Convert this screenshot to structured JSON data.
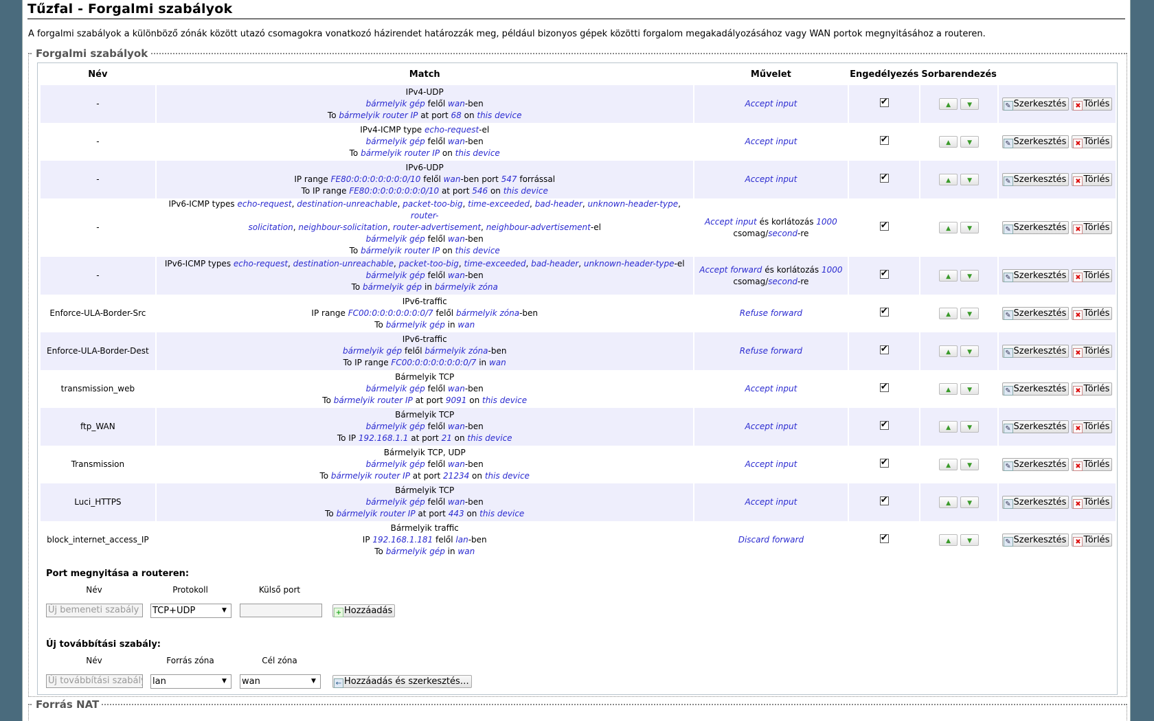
{
  "title": "Tűzfal - Forgalmi szabályok",
  "description": "A forgalmi szabályok a különböző zónák között utazó csomagokra vonatkozó házirendet határozzák meg, például bizonyos gépek közötti forgalom megakadályozásához vagy WAN portok megnyitásához a routeren.",
  "rules_section": {
    "legend": "Forgalmi szabályok",
    "headers": [
      "Név",
      "Match",
      "Művelet",
      "Engedélyezés",
      "Sorbarendezés"
    ],
    "edit_label": "Szerkesztés",
    "delete_label": "Törlés"
  },
  "rules": [
    {
      "name": "-",
      "match": [
        [
          {
            "t": "IPv4-UDP"
          }
        ],
        [
          {
            "t": "bármelyik gép",
            "e": 1
          },
          {
            "t": " felől "
          },
          {
            "t": "wan",
            "e": 1
          },
          {
            "t": "-ben"
          }
        ],
        [
          {
            "t": "To "
          },
          {
            "t": "bármelyik router IP",
            "e": 1
          },
          {
            "t": " at port "
          },
          {
            "t": "68",
            "e": 1
          },
          {
            "t": " on "
          },
          {
            "t": "this device",
            "e": 1
          }
        ]
      ],
      "action": [
        [
          {
            "t": "Accept input",
            "e": 1
          }
        ]
      ],
      "enabled": true
    },
    {
      "name": "-",
      "match": [
        [
          {
            "t": "IPv4-ICMP type "
          },
          {
            "t": "echo-request",
            "e": 1
          },
          {
            "t": "-el"
          }
        ],
        [
          {
            "t": "bármelyik gép",
            "e": 1
          },
          {
            "t": " felől "
          },
          {
            "t": "wan",
            "e": 1
          },
          {
            "t": "-ben"
          }
        ],
        [
          {
            "t": "To "
          },
          {
            "t": "bármelyik router IP",
            "e": 1
          },
          {
            "t": " on "
          },
          {
            "t": "this device",
            "e": 1
          }
        ]
      ],
      "action": [
        [
          {
            "t": "Accept input",
            "e": 1
          }
        ]
      ],
      "enabled": true
    },
    {
      "name": "-",
      "match": [
        [
          {
            "t": "IPv6-UDP"
          }
        ],
        [
          {
            "t": "IP range "
          },
          {
            "t": "FE80:0:0:0:0:0:0:0/10",
            "e": 1
          },
          {
            "t": " felől "
          },
          {
            "t": "wan",
            "e": 1
          },
          {
            "t": "-ben port "
          },
          {
            "t": "547",
            "e": 1
          },
          {
            "t": " forrással"
          }
        ],
        [
          {
            "t": "To IP range "
          },
          {
            "t": "FE80:0:0:0:0:0:0:0/10",
            "e": 1
          },
          {
            "t": " at port "
          },
          {
            "t": "546",
            "e": 1
          },
          {
            "t": " on "
          },
          {
            "t": "this device",
            "e": 1
          }
        ]
      ],
      "action": [
        [
          {
            "t": "Accept input",
            "e": 1
          }
        ]
      ],
      "enabled": true
    },
    {
      "name": "-",
      "match": [
        [
          {
            "t": "IPv6-ICMP types "
          },
          {
            "t": "echo-request",
            "e": 1
          },
          {
            "t": ", "
          },
          {
            "t": "destination-unreachable",
            "e": 1
          },
          {
            "t": ", "
          },
          {
            "t": "packet-too-big",
            "e": 1
          },
          {
            "t": ", "
          },
          {
            "t": "time-exceeded",
            "e": 1
          },
          {
            "t": ", "
          },
          {
            "t": "bad-header",
            "e": 1
          },
          {
            "t": ", "
          },
          {
            "t": "unknown-header-type",
            "e": 1
          },
          {
            "t": ", "
          },
          {
            "t": "router-",
            "e": 1
          }
        ],
        [
          {
            "t": "solicitation",
            "e": 1
          },
          {
            "t": ", "
          },
          {
            "t": "neighbour-solicitation",
            "e": 1
          },
          {
            "t": ", "
          },
          {
            "t": "router-advertisement",
            "e": 1
          },
          {
            "t": ", "
          },
          {
            "t": "neighbour-advertisement",
            "e": 1
          },
          {
            "t": "-el"
          }
        ],
        [
          {
            "t": "bármelyik gép",
            "e": 1
          },
          {
            "t": " felől "
          },
          {
            "t": "wan",
            "e": 1
          },
          {
            "t": "-ben"
          }
        ],
        [
          {
            "t": "To "
          },
          {
            "t": "bármelyik router IP",
            "e": 1
          },
          {
            "t": " on "
          },
          {
            "t": "this device",
            "e": 1
          }
        ]
      ],
      "action": [
        [
          {
            "t": "Accept input",
            "e": 1
          },
          {
            "t": " és korlátozás "
          },
          {
            "t": "1000",
            "e": 1
          }
        ],
        [
          {
            "t": "csomag/"
          },
          {
            "t": "second",
            "e": 1
          },
          {
            "t": "-re"
          }
        ]
      ],
      "enabled": true
    },
    {
      "name": "-",
      "match": [
        [
          {
            "t": "IPv6-ICMP types "
          },
          {
            "t": "echo-request",
            "e": 1
          },
          {
            "t": ", "
          },
          {
            "t": "destination-unreachable",
            "e": 1
          },
          {
            "t": ", "
          },
          {
            "t": "packet-too-big",
            "e": 1
          },
          {
            "t": ", "
          },
          {
            "t": "time-exceeded",
            "e": 1
          },
          {
            "t": ", "
          },
          {
            "t": "bad-header",
            "e": 1
          },
          {
            "t": ", "
          },
          {
            "t": "unknown-header-type",
            "e": 1
          },
          {
            "t": "-el"
          }
        ],
        [
          {
            "t": "bármelyik gép",
            "e": 1
          },
          {
            "t": " felől "
          },
          {
            "t": "wan",
            "e": 1
          },
          {
            "t": "-ben"
          }
        ],
        [
          {
            "t": "To "
          },
          {
            "t": "bármelyik gép",
            "e": 1
          },
          {
            "t": " in "
          },
          {
            "t": "bármelyik zóna",
            "e": 1
          }
        ]
      ],
      "action": [
        [
          {
            "t": "Accept forward",
            "e": 1
          },
          {
            "t": " és korlátozás "
          },
          {
            "t": "1000",
            "e": 1
          }
        ],
        [
          {
            "t": "csomag/"
          },
          {
            "t": "second",
            "e": 1
          },
          {
            "t": "-re"
          }
        ]
      ],
      "enabled": true
    },
    {
      "name": "Enforce-ULA-Border-Src",
      "match": [
        [
          {
            "t": "IPv6-traffic"
          }
        ],
        [
          {
            "t": "IP range "
          },
          {
            "t": "FC00:0:0:0:0:0:0:0/7",
            "e": 1
          },
          {
            "t": " felől "
          },
          {
            "t": "bármelyik zóna",
            "e": 1
          },
          {
            "t": "-ben"
          }
        ],
        [
          {
            "t": "To "
          },
          {
            "t": "bármelyik gép",
            "e": 1
          },
          {
            "t": " in "
          },
          {
            "t": "wan",
            "e": 1
          }
        ]
      ],
      "action": [
        [
          {
            "t": "Refuse forward",
            "e": 1
          }
        ]
      ],
      "enabled": true
    },
    {
      "name": "Enforce-ULA-Border-Dest",
      "match": [
        [
          {
            "t": "IPv6-traffic"
          }
        ],
        [
          {
            "t": "bármelyik gép",
            "e": 1
          },
          {
            "t": " felől "
          },
          {
            "t": "bármelyik zóna",
            "e": 1
          },
          {
            "t": "-ben"
          }
        ],
        [
          {
            "t": "To IP range "
          },
          {
            "t": "FC00:0:0:0:0:0:0:0/7",
            "e": 1
          },
          {
            "t": " in "
          },
          {
            "t": "wan",
            "e": 1
          }
        ]
      ],
      "action": [
        [
          {
            "t": "Refuse forward",
            "e": 1
          }
        ]
      ],
      "enabled": true
    },
    {
      "name": "transmission_web",
      "match": [
        [
          {
            "t": "Bármelyik TCP"
          }
        ],
        [
          {
            "t": "bármelyik gép",
            "e": 1
          },
          {
            "t": " felől "
          },
          {
            "t": "wan",
            "e": 1
          },
          {
            "t": "-ben"
          }
        ],
        [
          {
            "t": "To "
          },
          {
            "t": "bármelyik router IP",
            "e": 1
          },
          {
            "t": " at port "
          },
          {
            "t": "9091",
            "e": 1
          },
          {
            "t": " on "
          },
          {
            "t": "this device",
            "e": 1
          }
        ]
      ],
      "action": [
        [
          {
            "t": "Accept input",
            "e": 1
          }
        ]
      ],
      "enabled": true
    },
    {
      "name": "ftp_WAN",
      "match": [
        [
          {
            "t": "Bármelyik TCP"
          }
        ],
        [
          {
            "t": "bármelyik gép",
            "e": 1
          },
          {
            "t": " felől "
          },
          {
            "t": "wan",
            "e": 1
          },
          {
            "t": "-ben"
          }
        ],
        [
          {
            "t": "To IP "
          },
          {
            "t": "192.168.1.1",
            "e": 1
          },
          {
            "t": " at port "
          },
          {
            "t": "21",
            "e": 1
          },
          {
            "t": " on "
          },
          {
            "t": "this device",
            "e": 1
          }
        ]
      ],
      "action": [
        [
          {
            "t": "Accept input",
            "e": 1
          }
        ]
      ],
      "enabled": true
    },
    {
      "name": "Transmission",
      "match": [
        [
          {
            "t": "Bármelyik TCP, UDP"
          }
        ],
        [
          {
            "t": "bármelyik gép",
            "e": 1
          },
          {
            "t": " felől "
          },
          {
            "t": "wan",
            "e": 1
          },
          {
            "t": "-ben"
          }
        ],
        [
          {
            "t": "To "
          },
          {
            "t": "bármelyik router IP",
            "e": 1
          },
          {
            "t": " at port "
          },
          {
            "t": "21234",
            "e": 1
          },
          {
            "t": " on "
          },
          {
            "t": "this device",
            "e": 1
          }
        ]
      ],
      "action": [
        [
          {
            "t": "Accept input",
            "e": 1
          }
        ]
      ],
      "enabled": true
    },
    {
      "name": "Luci_HTTPS",
      "match": [
        [
          {
            "t": "Bármelyik TCP"
          }
        ],
        [
          {
            "t": "bármelyik gép",
            "e": 1
          },
          {
            "t": " felől "
          },
          {
            "t": "wan",
            "e": 1
          },
          {
            "t": "-ben"
          }
        ],
        [
          {
            "t": "To "
          },
          {
            "t": "bármelyik router IP",
            "e": 1
          },
          {
            "t": " at port "
          },
          {
            "t": "443",
            "e": 1
          },
          {
            "t": " on "
          },
          {
            "t": "this device",
            "e": 1
          }
        ]
      ],
      "action": [
        [
          {
            "t": "Accept input",
            "e": 1
          }
        ]
      ],
      "enabled": true
    },
    {
      "name": "block_internet_access_IP",
      "match": [
        [
          {
            "t": "Bármelyik traffic"
          }
        ],
        [
          {
            "t": "IP "
          },
          {
            "t": "192.168.1.181",
            "e": 1
          },
          {
            "t": " felől "
          },
          {
            "t": "lan",
            "e": 1
          },
          {
            "t": "-ben"
          }
        ],
        [
          {
            "t": "To "
          },
          {
            "t": "bármelyik gép",
            "e": 1
          },
          {
            "t": " in "
          },
          {
            "t": "wan",
            "e": 1
          }
        ]
      ],
      "action": [
        [
          {
            "t": "Discard forward",
            "e": 1
          }
        ]
      ],
      "enabled": true
    }
  ],
  "open_port": {
    "title": "Port megnyitása a routeren:",
    "col_name": "Név",
    "col_protocol": "Protokoll",
    "col_external_port": "Külső port",
    "name_placeholder": "Új bemeneti szabály",
    "protocol_value": "TCP+UDP",
    "external_port_value": "",
    "add_label": "Hozzáadás"
  },
  "new_forward": {
    "title": "Új továbbítási szabály:",
    "col_name": "Név",
    "col_src_zone": "Forrás zóna",
    "col_dest_zone": "Cél zóna",
    "name_placeholder": "Új továbbítási szabály",
    "src_zone_value": "lan",
    "dest_zone_value": "wan",
    "add_edit_label": "Hozzáadás és szerkesztés…"
  },
  "nat_section": {
    "legend": "Forrás NAT"
  },
  "colors": {
    "link": "#2a2ad0",
    "row_alt": "#eeeefc",
    "background": "#4a6b7d"
  }
}
